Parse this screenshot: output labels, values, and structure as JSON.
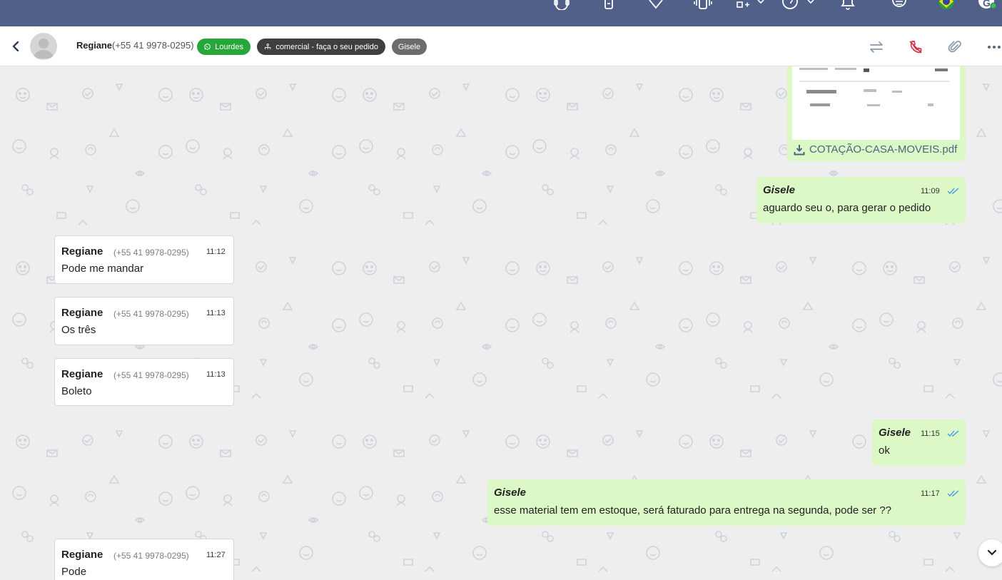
{
  "topbar": {
    "icons": [
      "headset-icon",
      "phone-device-icon",
      "tag-icon",
      "vibrate-phone-icon",
      "apps-add-icon",
      "help-icon",
      "bell-icon",
      "notes-icon",
      "brazil-flag-icon",
      "user-avatar-icon"
    ],
    "user_initial": "G"
  },
  "header": {
    "contact_name": "Regiane",
    "contact_phone": "(+55 41 9978-0295)",
    "tags": {
      "channel": "Lourdes",
      "queue": "comercial - faça o seu pedido",
      "agent": "Gisele"
    },
    "actions": [
      "transfer-icon",
      "end-call-icon",
      "attach-icon",
      "more-icon"
    ]
  },
  "messages": [
    {
      "direction": "out",
      "type": "file",
      "file_name": "COTAÇÃO-CASA-MOVEIS.pdf"
    },
    {
      "direction": "out",
      "sender": "Gisele",
      "time": "11:09",
      "text": "aguardo seu o, para gerar o pedido",
      "status": "read"
    },
    {
      "direction": "in",
      "sender": "Regiane",
      "phone": "(+55 41 9978-0295)",
      "time": "11:12",
      "text": "Pode me mandar"
    },
    {
      "direction": "in",
      "sender": "Regiane",
      "phone": "(+55 41 9978-0295)",
      "time": "11:13",
      "text": "Os três"
    },
    {
      "direction": "in",
      "sender": "Regiane",
      "phone": "(+55 41 9978-0295)",
      "time": "11:13",
      "text": "Boleto"
    },
    {
      "direction": "out",
      "sender": "Gisele",
      "time": "11:15",
      "text": "ok",
      "status": "read"
    },
    {
      "direction": "out",
      "sender": "Gisele",
      "time": "11:17",
      "text": "esse material tem em estoque, será faturado para entrega na segunda, pode ser ??",
      "status": "read"
    },
    {
      "direction": "in",
      "sender": "Regiane",
      "phone": "(+55 41 9978-0295)",
      "time": "11:27",
      "text": "Pode"
    }
  ],
  "colors": {
    "topbar": "#516089",
    "outgoing_bubble": "#dcf8c6",
    "incoming_bubble": "#ffffff",
    "read_ticks": "#4fa3e0",
    "tag_green": "#27a63a",
    "tag_dark": "#3f3f3f",
    "tag_gray": "#6c6c6c",
    "end_call": "#d6334a"
  }
}
